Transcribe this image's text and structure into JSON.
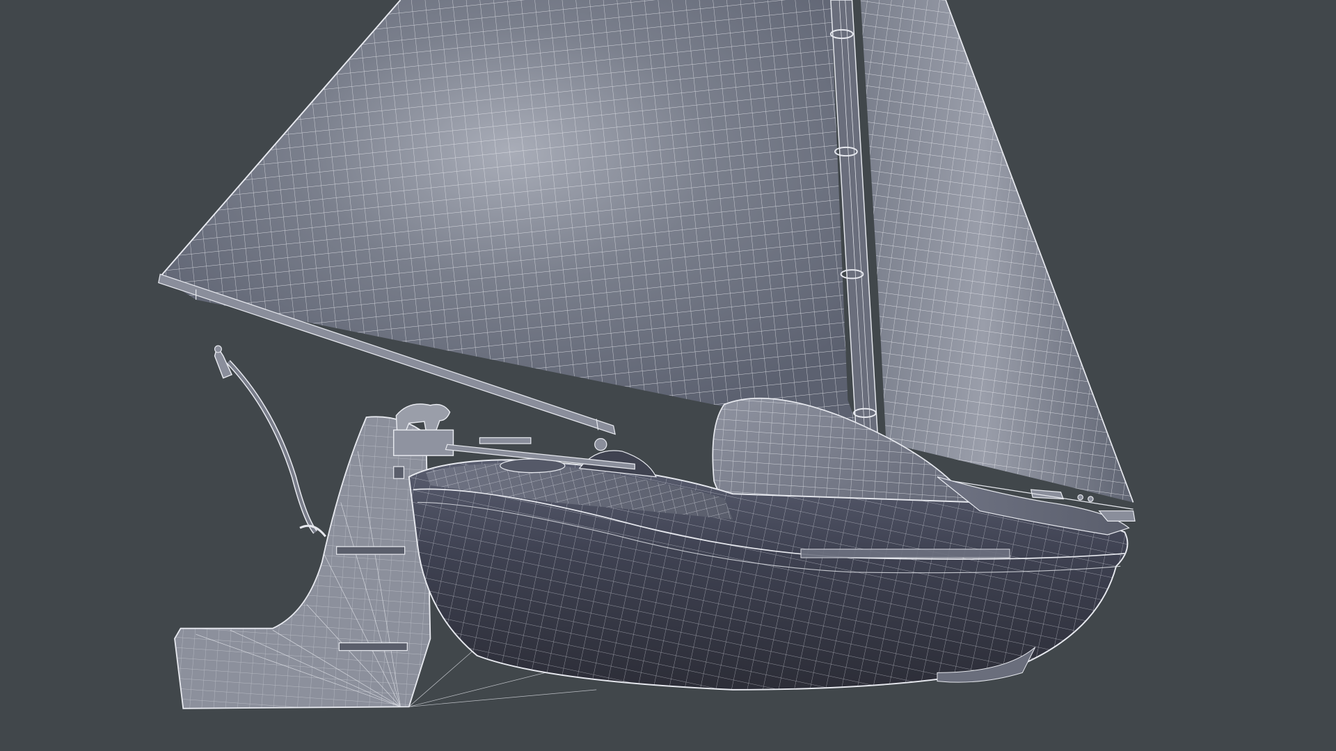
{
  "scene": {
    "subject": "sailboat-wireframe-render",
    "colors": {
      "background": "#41474b",
      "sail_fill": "#6d7380",
      "sail_highlight": "#a9adb8",
      "hull_fill": "#4a4e5e",
      "hull_dark": "#2e303a",
      "wood_fill": "#9a9ba3",
      "wire": "#e6e8ee",
      "wire_soft": "#c9ccd6"
    }
  }
}
